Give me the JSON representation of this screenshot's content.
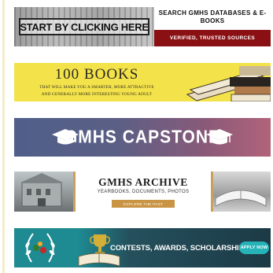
{
  "banners": {
    "databases": {
      "cta_text": "START BY CLICKING HERE",
      "title": "SEARCH GMHS DATABASES & E-BOOKS",
      "tagline": "VERIFIED, TRUSTED SOURCES",
      "accent_color": "#8b1014"
    },
    "books": {
      "title": "100 BOOKS",
      "subtitle_line1": "THAT WILL MAKE YOU A SMARTER, MORE ATTRACTIVE",
      "subtitle_line2": "AND GENERALLY MORE INTERESTING YOUNG ADULT",
      "background_color": "#f3e24a"
    },
    "capstone": {
      "title": "GMHS CAPSTONE",
      "icon": "graduation-cap-icon"
    },
    "archive": {
      "title": "GMHS ARCHIVE",
      "subtitle": "YEARBOOKS, DOCUMENTS, PHOTOS",
      "button_label": "EXPLORE THE PAST",
      "accent_color": "#c99443"
    },
    "contests": {
      "title": "CONTESTS, AWARDS, SCHOLARSHIPS",
      "button_label": "APPLY NOW",
      "icons": [
        "laurel-wreath-icon",
        "trophy-icon",
        "open-book-icon"
      ]
    }
  }
}
